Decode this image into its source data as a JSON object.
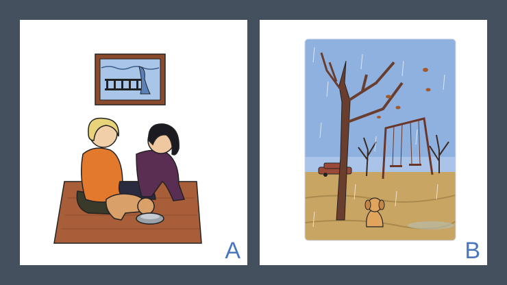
{
  "colors": {
    "background": "#44505e",
    "panel": "#ffffff",
    "letter": "#4a76c0",
    "rug": "#a85e38",
    "sky": "#8fb1e0",
    "ground": "#c8a562"
  },
  "panels": [
    {
      "letter": "A"
    },
    {
      "letter": "B"
    }
  ]
}
